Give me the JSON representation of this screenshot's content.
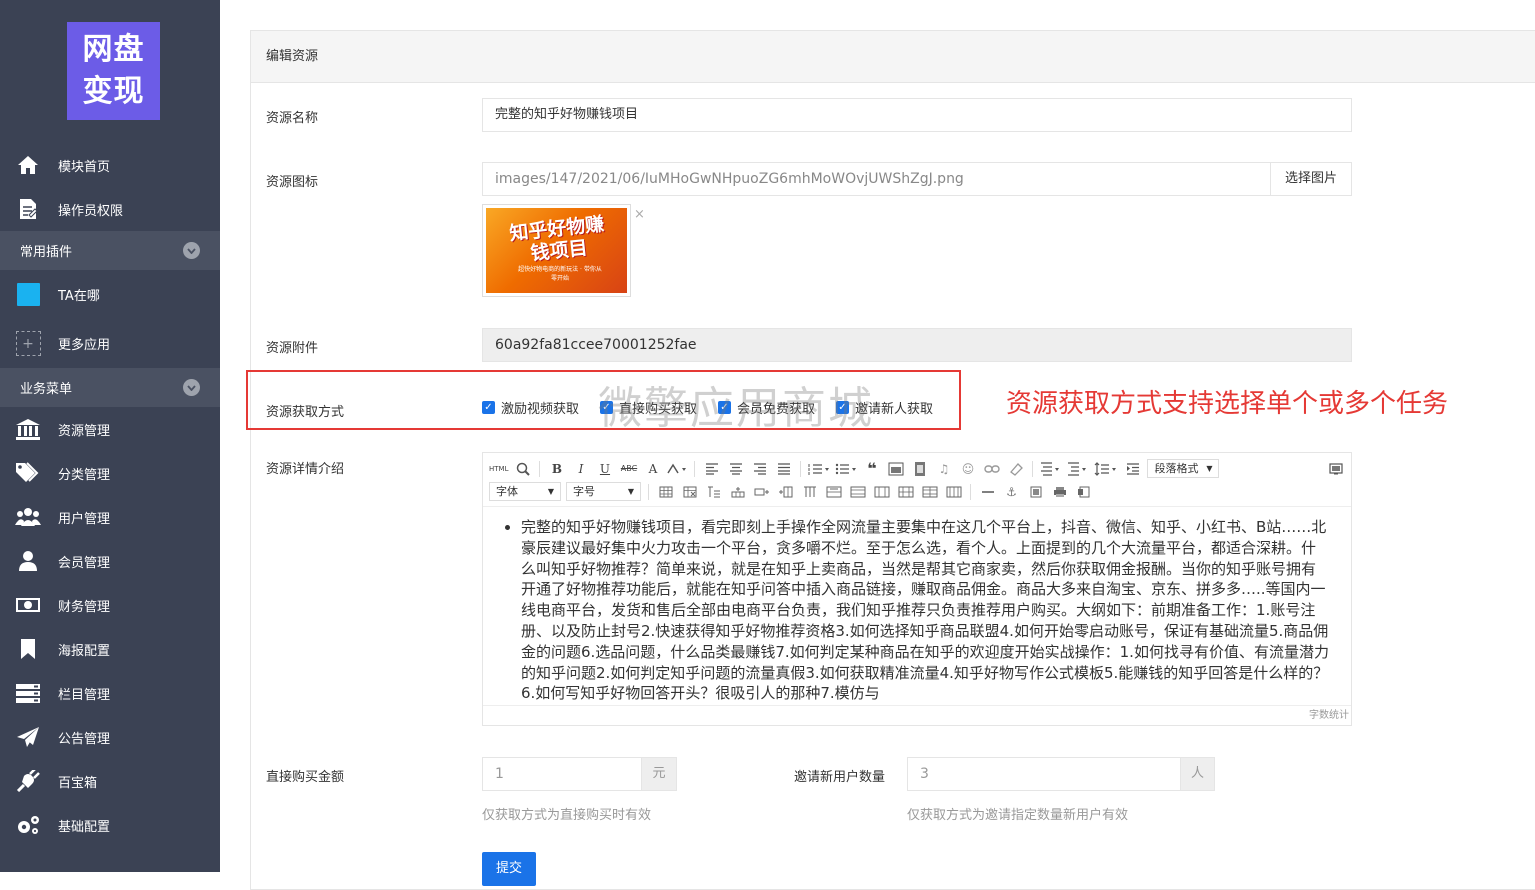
{
  "sidebar": {
    "logo_line1": "网盘",
    "logo_line2": "变现",
    "top_items": [
      {
        "label": "模块首页",
        "icon": "home-icon"
      },
      {
        "label": "操作员权限",
        "icon": "edit-icon"
      }
    ],
    "group_plugins": "常用插件",
    "ta_label": "TA在哪",
    "more_label": "更多应用",
    "more_icon_char": "+",
    "group_business": "业务菜单",
    "business_items": [
      {
        "label": "资源管理",
        "icon": "bank-icon"
      },
      {
        "label": "分类管理",
        "icon": "tag-icon"
      },
      {
        "label": "用户管理",
        "icon": "users-icon"
      },
      {
        "label": "会员管理",
        "icon": "user-icon"
      },
      {
        "label": "财务管理",
        "icon": "money-icon"
      },
      {
        "label": "海报配置",
        "icon": "bookmark-icon"
      },
      {
        "label": "栏目管理",
        "icon": "server-icon"
      },
      {
        "label": "公告管理",
        "icon": "paper-plane-icon"
      },
      {
        "label": "百宝箱",
        "icon": "plug-icon"
      },
      {
        "label": "基础配置",
        "icon": "gears-icon"
      }
    ]
  },
  "panel": {
    "title": "编辑资源"
  },
  "form": {
    "name_label": "资源名称",
    "name_value": "完整的知乎好物赚钱项目",
    "icon_label": "资源图标",
    "icon_value": "images/147/2021/06/IuMHoGwNHpuoZG6mhMoWOvjUWShZgJ.png",
    "icon_button": "选择图片",
    "thumb_title": "知乎好物赚钱项目",
    "thumb_sub": "超快好物电商的新玩法 · 带你从零开始",
    "thumb_close": "×",
    "attach_label": "资源附件",
    "attach_value": "60a92fa81ccee70001252fae",
    "method_label": "资源获取方式",
    "methods": [
      {
        "label": "激励视频获取",
        "checked": true
      },
      {
        "label": "直接购买获取",
        "checked": true
      },
      {
        "label": "会员免费获取",
        "checked": true
      },
      {
        "label": "邀请新人获取",
        "checked": true
      }
    ],
    "detail_label": "资源详情介绍",
    "price_label": "直接购买金额",
    "price_value": "1",
    "price_unit": "元",
    "price_help": "仅获取方式为直接购买时有效",
    "invite_label": "邀请新用户数量",
    "invite_value": "3",
    "invite_unit": "人",
    "invite_help": "仅获取方式为邀请指定数量新用户有效",
    "submit": "提交"
  },
  "editor": {
    "html_btn": "HTML",
    "bold": "B",
    "italic": "I",
    "underline": "U",
    "strike": "ABC",
    "font_color": "A",
    "paragraph_format": "段落格式",
    "font_family": "字体",
    "font_size": "字号",
    "word_count": "字数统计",
    "content": "完整的知乎好物赚钱项目，看完即刻上手操作全网流量主要集中在这几个平台上，抖音、微信、知乎、小红书、B站……北豪辰建议最好集中火力攻击一个平台，贪多嚼不烂。至于怎么选，看个人。上面提到的几个大流量平台，都适合深耕。什么叫知乎好物推荐？简单来说，就是在知乎上卖商品，当然是帮其它商家卖，然后你获取佣金报酬。当你的知乎账号拥有开通了好物推荐功能后，就能在知乎问答中插入商品链接，赚取商品佣金。商品大多来自淘宝、京东、拼多多…..等国内一线电商平台，发货和售后全部由电商平台负责，我们知乎推荐只负责推荐用户购买。大纲如下：前期准备工作：1.账号注册、以及防止封号2.快速获得知乎好物推荐资格3.如何选择知乎商品联盟4.如何开始零启动账号，保证有基础流量5.商品佣金的问题6.选品问题，什么品类最赚钱7.如何判定某种商品在知乎的欢迎度开始实战操作：1.如何找寻有价值、有流量潜力的知乎问题2.如何判定知乎问题的流量真假3.如何获取精准流量4.知乎好物写作公式模板5.能赚钱的知乎回答是什么样的？6.如何写知乎好物回答开头？很吸引人的那种7.模仿与"
  },
  "annotation": "资源获取方式支持选择单个或多个任务",
  "watermark": "微擎应用商城",
  "colors": {
    "sidebar_bg": "#3b4254",
    "group_bg": "#4a5162",
    "logo_bg": "#6c5ce7",
    "accent": "#1a73e8",
    "highlight": "#e53935"
  }
}
